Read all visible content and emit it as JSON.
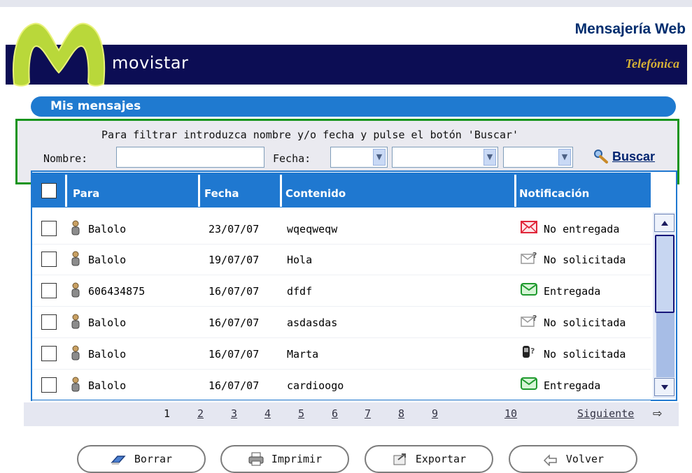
{
  "header": {
    "app_title": "Mensajería Web",
    "brand_name": "movistar",
    "partner": "Telefónica"
  },
  "section": {
    "title": "Mis mensajes"
  },
  "filter": {
    "hint": "Para filtrar introduzca nombre y/o fecha y pulse el botón 'Buscar'",
    "nombre_label": "Nombre:",
    "nombre_value": "",
    "fecha_label": "Fecha:",
    "day_value": "",
    "month_value": "",
    "year_value": "",
    "search_label": "Buscar"
  },
  "table": {
    "columns": [
      "Para",
      "Fecha",
      "Contenido",
      "Notificación"
    ],
    "rows": [
      {
        "para": "Balolo",
        "fecha": "23/07/07",
        "contenido": "wqeqweqw",
        "notificacion": "No entregada",
        "status_icon": "envelope-failed-icon"
      },
      {
        "para": "Balolo",
        "fecha": "19/07/07",
        "contenido": "Hola",
        "notificacion": "No solicitada",
        "status_icon": "envelope-question-icon"
      },
      {
        "para": "606434875",
        "fecha": "16/07/07",
        "contenido": "dfdf",
        "notificacion": "Entregada",
        "status_icon": "envelope-delivered-icon"
      },
      {
        "para": "Balolo",
        "fecha": "16/07/07",
        "contenido": "asdasdas",
        "notificacion": "No solicitada",
        "status_icon": "envelope-question-icon"
      },
      {
        "para": "Balolo",
        "fecha": "16/07/07",
        "contenido": "Marta",
        "notificacion": "No solicitada",
        "status_icon": "phone-question-icon"
      },
      {
        "para": "Balolo",
        "fecha": "16/07/07",
        "contenido": "cardioogo",
        "notificacion": "Entregada",
        "status_icon": "envelope-delivered-icon"
      }
    ]
  },
  "pager": {
    "pages": [
      "1",
      "2",
      "3",
      "4",
      "5",
      "6",
      "7",
      "8",
      "9",
      "10"
    ],
    "current": "1",
    "next_label": "Siguiente"
  },
  "actions": {
    "delete_label": "Borrar",
    "print_label": "Imprimir",
    "export_label": "Exportar",
    "back_label": "Volver"
  },
  "colors": {
    "brand_bar": "#0c0d54",
    "accent_blue": "#1f78d0",
    "highlight_frame": "#17941c",
    "failed_red": "#e0263a",
    "delivered_green": "#1f9a2e"
  }
}
